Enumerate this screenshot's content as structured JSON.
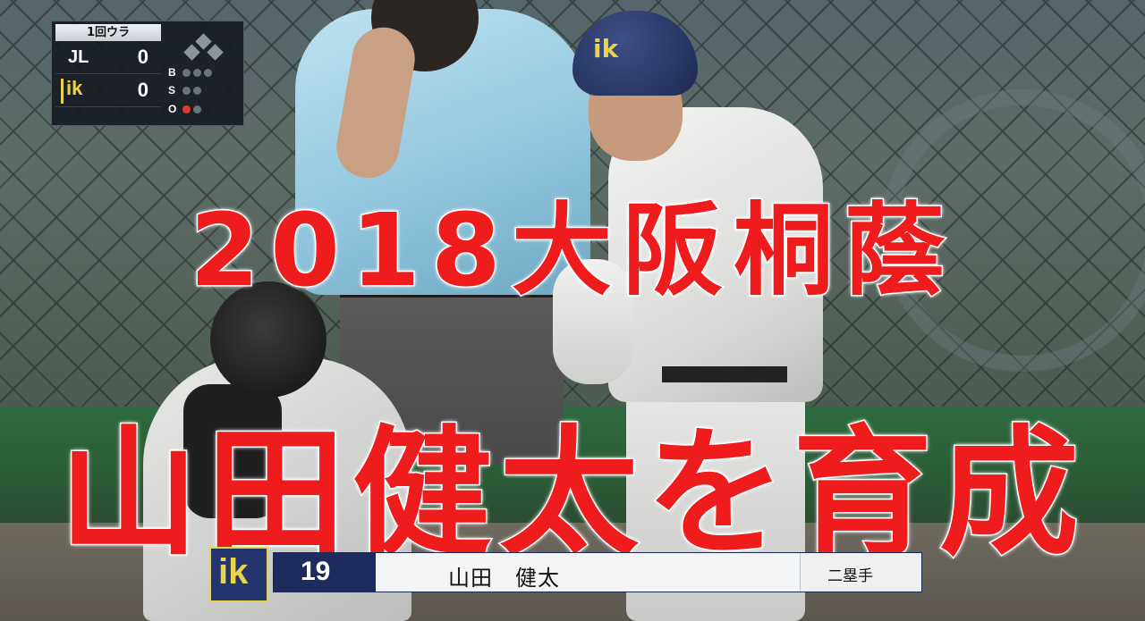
{
  "scoreboard": {
    "inning": "1回ウラ",
    "away": {
      "abbr": "JL",
      "score": "0"
    },
    "home": {
      "abbr": "ik",
      "score": "0"
    },
    "count_labels": {
      "balls": "B",
      "strikes": "S",
      "outs": "O"
    },
    "balls": 0,
    "strikes": 0,
    "outs": 1
  },
  "overlay": {
    "line1": "2018大阪桐蔭",
    "line2": "山田健太を育成"
  },
  "player_bar": {
    "team_logo": "ik",
    "number": "19",
    "name": "山田　健太",
    "position": "二塁手"
  },
  "colors": {
    "title_red": "#ee1c1c",
    "team_navy": "#1d2c5d",
    "team_gold": "#e9d34a"
  }
}
